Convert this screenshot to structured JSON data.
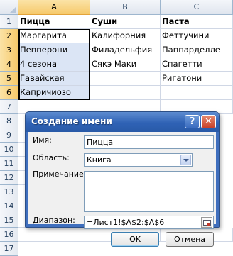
{
  "sheet": {
    "columns": [
      "A",
      "B",
      "C"
    ],
    "rows": [
      "1",
      "2",
      "3",
      "4",
      "5",
      "6",
      "7",
      "8",
      "9",
      "10",
      "11",
      "12",
      "13",
      "14",
      "15",
      "16",
      "17"
    ],
    "headers": {
      "a": "Пицца",
      "b": "Суши",
      "c": "Паста"
    },
    "col_a": [
      "Маргарита",
      "Пепперони",
      "4 сезона",
      "Гавайская",
      "Капричиозо"
    ],
    "col_b": [
      "Калифорния",
      "Филадельфия",
      "Сякэ Маки"
    ],
    "col_c": [
      "Феттучини",
      "Паппарделле",
      "Спагетти",
      "Ригатони"
    ]
  },
  "dialog": {
    "title": "Создание имени",
    "help_glyph": "?",
    "close_glyph": "✕",
    "name_label": "Имя:",
    "name_value": "Пицца",
    "scope_label": "Область:",
    "scope_value": "Книга",
    "comment_label": "Примечание:",
    "comment_value": "",
    "range_label": "Диапазон:",
    "range_value": "=Лист1!$A$2:$A$6",
    "ok_label": "OK",
    "cancel_label": "Отмена"
  },
  "colors": {
    "selection_header": "#f6c96b",
    "selection_fill": "#dbe5f5",
    "titlebar": "#2f62b5"
  }
}
